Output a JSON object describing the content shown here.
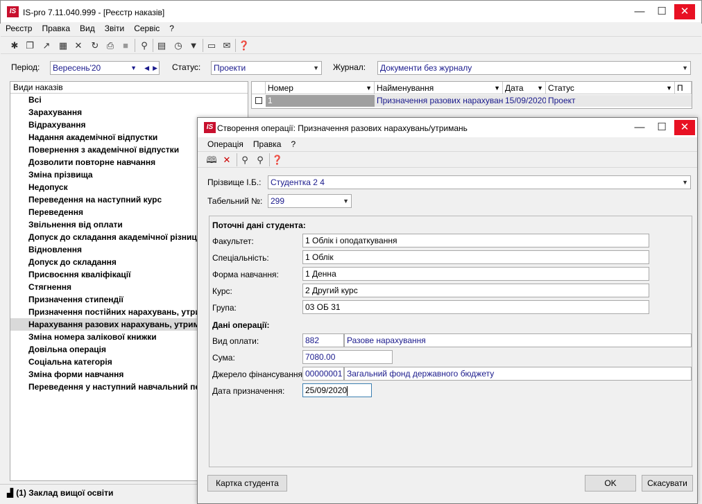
{
  "window": {
    "logo": "IS",
    "title": "IS-pro 7.11.040.999 - [Реєстр наказів]",
    "minimize": "—",
    "maximize": "☐",
    "close": "✕"
  },
  "menu": [
    "Реєстр",
    "Правка",
    "Вид",
    "Звіти",
    "Сервіс",
    "?"
  ],
  "filters": {
    "period_label": "Період:",
    "period_value": "Вересень'20",
    "status_label": "Статус:",
    "status_value": "Проекти",
    "journal_label": "Журнал:",
    "journal_value": "Документи без журналу"
  },
  "left_panel": {
    "header": "Види наказів",
    "items": [
      "Всі",
      "Зарахування",
      "Відрахування",
      "Надання академічної відпустки",
      "Повернення з академічної відпустки",
      "Дозволити повторне навчання",
      "Зміна прізвища",
      "Недопуск",
      "Переведення на наступний курс",
      "Переведення",
      "Звільнення від оплати",
      "Допуск до складання академічної різниці",
      "Відновлення",
      "Допуск до складання",
      "Присвоєння кваліфікації",
      "Стягнення",
      "Призначення стипендії",
      "Призначення постійних нарахувань, утримань",
      "Нарахування разових нарахувань, утримань",
      "Зміна номера залікової книжки",
      "Довільна операція",
      "Соціальна категорія",
      "Зміна форми навчання",
      "Переведення у наступний навчальний період"
    ],
    "selected_index": 18
  },
  "grid": {
    "columns": [
      "Номер",
      "Найменування",
      "Дата",
      "Статус",
      "П"
    ],
    "rows": [
      {
        "number": "1",
        "name": "Призначення разових нарахувань",
        "date": "15/09/2020",
        "status": "Проект"
      }
    ]
  },
  "statusbar": {
    "text": "(1) Заклад вищої освіти"
  },
  "dialog": {
    "title": "Створення операції: Призначення разових нарахувань/утримань",
    "menu": [
      "Операція",
      "Правка",
      "?"
    ],
    "surname_label": "Прізвище І.Б.:",
    "surname_value": "Студентка 2 4",
    "tab_label": "Табельний №:",
    "tab_value": "299",
    "section_current": "Поточні дані студента:",
    "faculty_label": "Факультет:",
    "faculty_value": "1 Облік і оподаткування",
    "specialty_label": "Спеціальність:",
    "specialty_value": "1 Облік",
    "form_label": "Форма навчання:",
    "form_value": "1 Денна",
    "course_label": "Курс:",
    "course_value": "2 Другий курс",
    "group_label": "Група:",
    "group_value": "03 ОБ 31",
    "section_operation": "Дані операції:",
    "paytype_label": "Вид оплати:",
    "paytype_code": "882",
    "paytype_name": "Разове нарахування",
    "sum_label": "Сума:",
    "sum_value": "7080.00",
    "source_label": "Джерело фінансування:",
    "source_code": "00000001",
    "source_name": "Загальний фонд державного бюджету",
    "date_label": "Дата призначення:",
    "date_value": "25/09/2020",
    "student_card_button": "Картка студента",
    "ok_button": "OK",
    "cancel_button": "Скасувати"
  }
}
